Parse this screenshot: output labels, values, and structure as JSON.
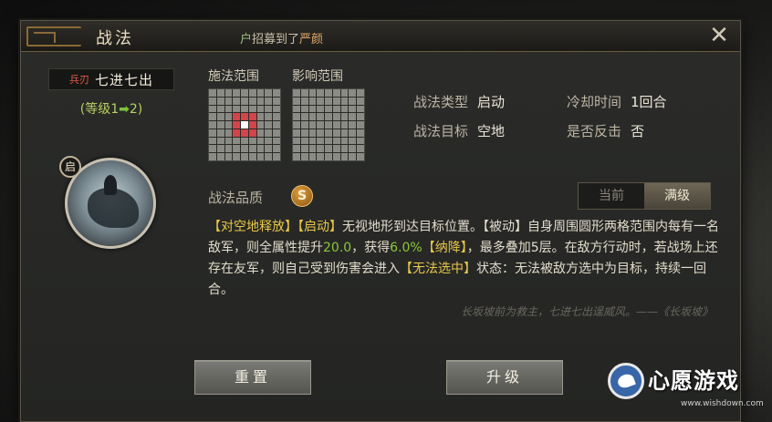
{
  "window": {
    "title": "战法",
    "notice_prefix": "户",
    "notice_text": "招募到了",
    "notice_highlight": "严颜",
    "close_icon": "close-icon"
  },
  "skill": {
    "weapon_tag": "兵刃",
    "name": "七进七出",
    "level_prefix": "(等级",
    "level_from": "1",
    "level_arrow": "➡",
    "level_to": "2",
    "level_suffix": ")",
    "avatar_badge": "启"
  },
  "ranges": {
    "cast_label": "施法范围",
    "effect_label": "影响范围",
    "cast_grid_size": 9,
    "cast_red_cells": [
      [
        3,
        4
      ],
      [
        4,
        3
      ],
      [
        4,
        5
      ],
      [
        5,
        4
      ],
      [
        5,
        3
      ],
      [
        3,
        3
      ],
      [
        3,
        5
      ],
      [
        5,
        5
      ]
    ],
    "cast_center_cell": [
      4,
      4
    ]
  },
  "info": {
    "type_label": "战法类型",
    "type_value": "启动",
    "cooldown_label": "冷却时间",
    "cooldown_value": "1回合",
    "target_label": "战法目标",
    "target_value": "空地",
    "counter_label": "是否反击",
    "counter_value": "否"
  },
  "quality": {
    "label": "战法品质",
    "grade": "S"
  },
  "toggle": {
    "current": "当前",
    "max": "满级"
  },
  "description": {
    "t1": "【对空地释放】【启动】",
    "t2": "无视地形到达目标位置。【被动】自身周围圆形两格范围内每有一名敌军，则全属性提升",
    "n1": "20.0",
    "t3": "，获得",
    "n2": "6.0%",
    "t4": "【纳降】",
    "t5": "，最多叠加5层。在敌方行动时，若战场上还存在友军，则自己受到伤害会进入",
    "t6": "【无法选中】",
    "t7": "状态：无法被敌方选中为目标，持续一回合。"
  },
  "quote": "长坂坡前为救主，七进七出逞威风。——《长坂坡》",
  "buttons": {
    "reset": "重置",
    "upgrade": "升级"
  },
  "watermark": {
    "title": "心愿游戏",
    "url": "www.wishdown.com"
  },
  "colors": {
    "accent_gold": "#e8c84a",
    "value_green": "#8ac838",
    "range_red": "#d2454a"
  }
}
